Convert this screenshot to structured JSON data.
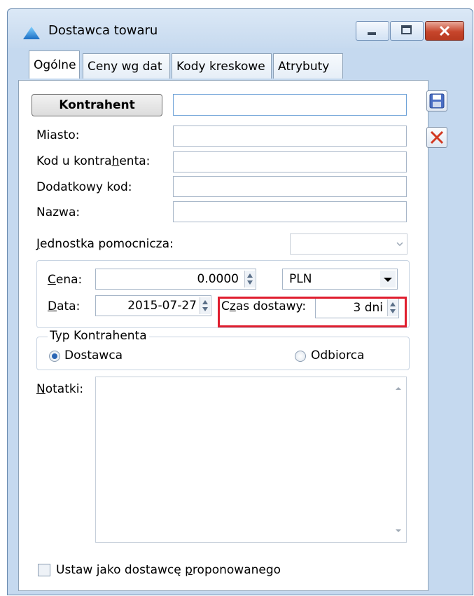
{
  "window": {
    "title": "Dostawca towaru"
  },
  "tabs": [
    {
      "label": "Ogólne"
    },
    {
      "label": "Ceny wg dat"
    },
    {
      "label": "Kody kreskowe"
    },
    {
      "label": "Atrybuty"
    }
  ],
  "form": {
    "kontrahent_button": "Kontrahent",
    "kontrahent_value": "",
    "miasto_label": "Miasto:",
    "kod_label_pre": "Kod u kontra",
    "kod_label_u": "h",
    "kod_label_post": "enta:",
    "dodatkowy_label": "Dodatkowy kod:",
    "nazwa_label": "Nazwa:",
    "jednostka_label_u": "J",
    "jednostka_label_post": "ednostka pomocnicza:",
    "cena_label_u": "C",
    "cena_label_post": "ena:",
    "cena_value": "0.0000",
    "currency": "PLN",
    "data_label_u": "D",
    "data_label_post": "ata:",
    "data_value": "2015-07-27",
    "czas_label_pre": "C",
    "czas_label_u": "z",
    "czas_label_post": "as dostawy:",
    "czas_value": "3 dni",
    "typ_group_title": "Typ Kontrahenta",
    "radio_dostawca": "Dostawca",
    "radio_odbiorca": "Odbiorca",
    "notatki_label_u": "N",
    "notatki_label_post": "otatki:",
    "checkbox_pre": "Ustaw jako dostawcę ",
    "checkbox_u": "p",
    "checkbox_post": "roponowanego"
  },
  "colors": {
    "highlight": "#e01e2f",
    "accent": "#2a65b5"
  }
}
